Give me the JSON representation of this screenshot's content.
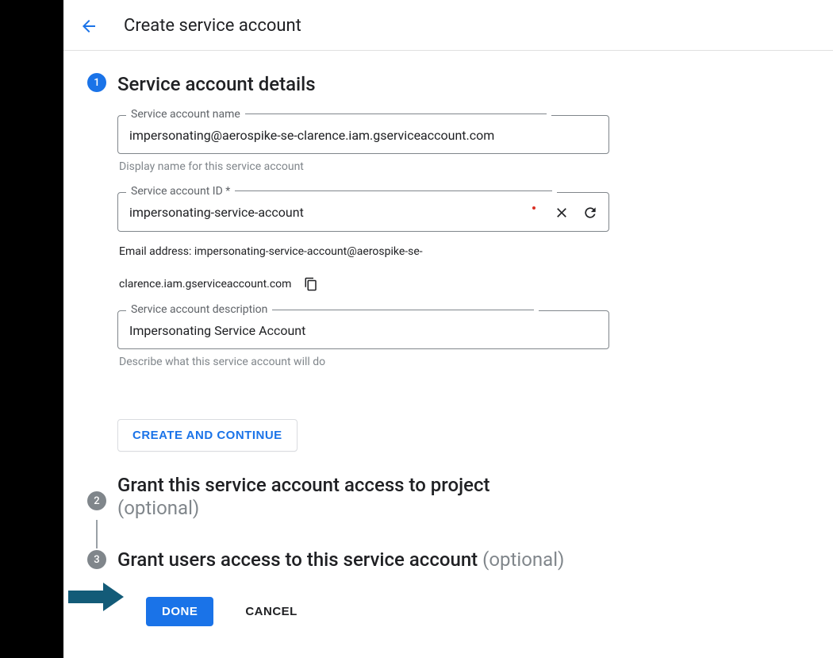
{
  "header": {
    "title": "Create service account"
  },
  "steps": {
    "one": {
      "num": "1",
      "title": "Service account details"
    },
    "two": {
      "num": "2",
      "title": "Grant this service account access to project",
      "optional": "(optional)"
    },
    "three": {
      "num": "3",
      "title": "Grant users access to this service account ",
      "optional": "(optional)"
    }
  },
  "form": {
    "name_label": "Service account name",
    "name_value": "impersonating@aerospike-se-clarence.iam.gserviceaccount.com",
    "name_helper": "Display name for this service account",
    "id_label": "Service account ID *",
    "id_value": "impersonating-service-account",
    "email_line1": "Email address: impersonating-service-account@aerospike-se-",
    "email_line2": "clarence.iam.gserviceaccount.com",
    "desc_label": "Service account description",
    "desc_value": "Impersonating Service Account",
    "desc_helper": "Describe what this service account will do"
  },
  "buttons": {
    "create_continue": "CREATE AND CONTINUE",
    "done": "DONE",
    "cancel": "CANCEL"
  }
}
